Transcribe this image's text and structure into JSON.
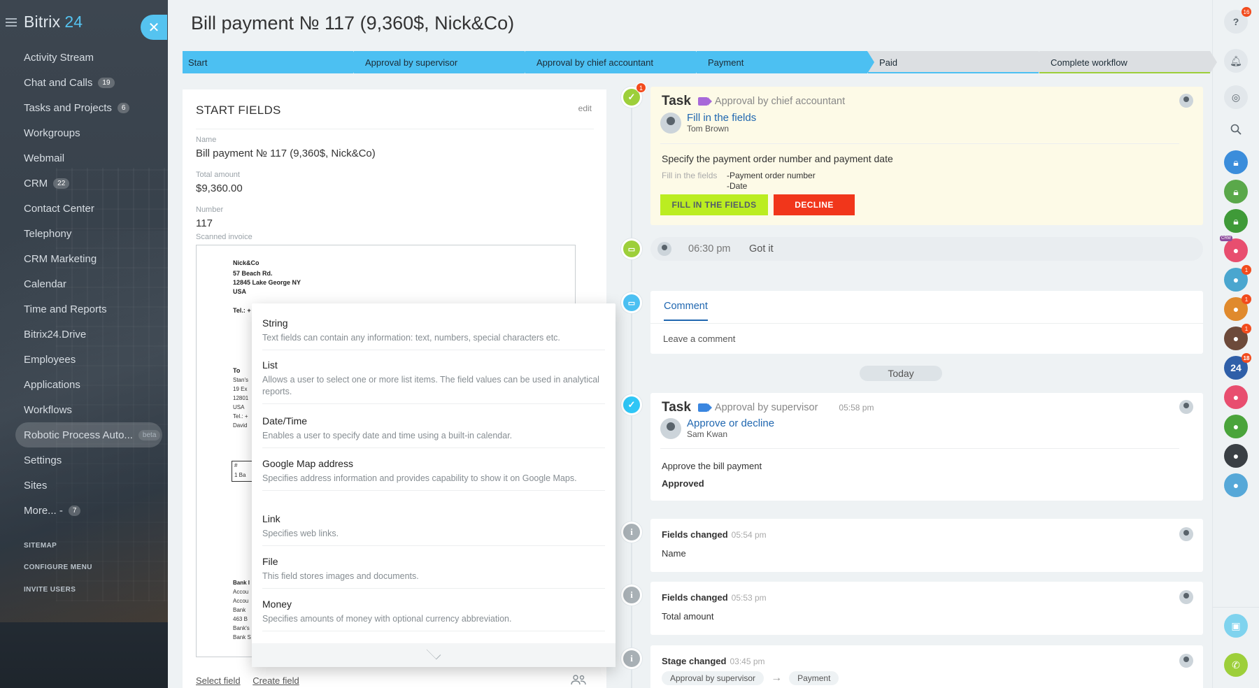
{
  "sidebar": {
    "brand": "Bitrix",
    "brand_num": "24",
    "items": [
      {
        "label": "Activity Stream",
        "count": ""
      },
      {
        "label": "Chat and Calls",
        "count": "19"
      },
      {
        "label": "Tasks and Projects",
        "count": "6"
      },
      {
        "label": "Workgroups",
        "count": ""
      },
      {
        "label": "Webmail",
        "count": ""
      },
      {
        "label": "CRM",
        "count": "22"
      },
      {
        "label": "Contact Center",
        "count": ""
      },
      {
        "label": "Telephony",
        "count": ""
      },
      {
        "label": "CRM Marketing",
        "count": ""
      },
      {
        "label": "Calendar",
        "count": ""
      },
      {
        "label": "Time and Reports",
        "count": ""
      },
      {
        "label": "Bitrix24.Drive",
        "count": ""
      },
      {
        "label": "Employees",
        "count": ""
      },
      {
        "label": "Applications",
        "count": ""
      },
      {
        "label": "Workflows",
        "count": ""
      },
      {
        "label": "Robotic Process Auto...",
        "count": "beta"
      },
      {
        "label": "Settings",
        "count": ""
      },
      {
        "label": "Sites",
        "count": ""
      },
      {
        "label": "More... -",
        "count": "7"
      }
    ],
    "sitemap": "SITEMAP",
    "configure": "CONFIGURE MENU",
    "invite": "INVITE USERS"
  },
  "header": {
    "title": "Bill payment № 117 (9,360$, Nick&Co)",
    "close": "✕"
  },
  "stages": [
    "Start",
    "Approval by supervisor",
    "Approval by chief accountant",
    "Payment",
    "Paid",
    "Complete workflow"
  ],
  "start_fields": {
    "title": "START FIELDS",
    "edit": "edit",
    "name_label": "Name",
    "name_value": "Bill payment № 117 (9,360$, Nick&Co)",
    "amount_label": "Total amount",
    "amount_value": "$9,360.00",
    "number_label": "Number",
    "number_value": "117",
    "invoice_label": "Scanned invoice",
    "invoice": {
      "company": "Nick&Co",
      "addr1": "57 Beach Rd.",
      "addr2": "12845 Lake George NY",
      "country": "USA",
      "tel": "Tel.: +",
      "to": "To",
      "to_lines": [
        "Stan's",
        "19 Ex",
        "12801",
        "USA",
        "Tel.: +",
        "David"
      ],
      "table": [
        "#",
        "1 Ba"
      ],
      "bank_head": "Bank I",
      "bank_lines": [
        "Accou",
        "Accou",
        "Bank",
        "463 B",
        "Bank's",
        "Bank S"
      ]
    },
    "select_field": "Select field",
    "create_field": "Create field"
  },
  "dropdown": [
    {
      "name": "String",
      "desc": "Text fields can contain any information: text, numbers, special characters etc."
    },
    {
      "name": "List",
      "desc": "Allows a user to select one or more list items. The field values can be used in analytical reports."
    },
    {
      "name": "Date/Time",
      "desc": "Enables a user to specify date and time using a built-in calendar."
    },
    {
      "name": "Google Map address",
      "desc": "Specifies address information and provides capability to show it on Google Maps."
    },
    {
      "name": "Link",
      "desc": "Specifies web links."
    },
    {
      "name": "File",
      "desc": "This field stores images and documents."
    },
    {
      "name": "Money",
      "desc": "Specifies amounts of money with optional currency abbreviation."
    }
  ],
  "timeline": {
    "task1": {
      "word": "Task",
      "stage": "Approval by chief accountant",
      "action": "Fill in the fields",
      "person": "Tom Brown",
      "text": "Specify the payment order number and payment date",
      "fields_label": "Fill in the fields",
      "fields": [
        "-Payment order number",
        "-Date"
      ],
      "btn_fill": "FILL IN THE FIELDS",
      "btn_decline": "DECLINE",
      "badge": "1"
    },
    "chat": {
      "time": "06:30 pm",
      "text": "Got it"
    },
    "comment": {
      "tab": "Comment",
      "placeholder": "Leave a comment"
    },
    "today": "Today",
    "task2": {
      "word": "Task",
      "stage": "Approval by supervisor",
      "time": "05:58 pm",
      "action": "Approve or decline",
      "person": "Sam Kwan",
      "text": "Approve the bill payment",
      "result": "Approved"
    },
    "events": [
      {
        "title": "Fields changed",
        "time": "05:54 pm",
        "detail": "Name"
      },
      {
        "title": "Fields changed",
        "time": "05:53 pm",
        "detail": "Total amount"
      },
      {
        "title": "Stage changed",
        "time": "03:45 pm",
        "from": "Approval by supervisor",
        "arrow": "→",
        "to": "Payment"
      }
    ],
    "info_icon": "i"
  },
  "rightbar": {
    "help_badge": "16",
    "badges": [
      "1",
      "1",
      "1",
      "18"
    ],
    "b24": "24",
    "crm_tag": "CRM"
  },
  "colors": {
    "accent": "#4cc0f2",
    "link": "#2067b0",
    "green_btn": "#bbed21",
    "red_btn": "#f1361b",
    "badge": "#f24b1d"
  }
}
